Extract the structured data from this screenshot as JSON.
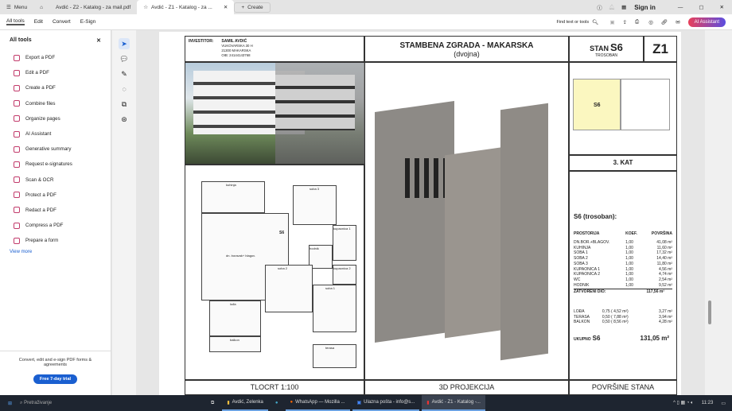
{
  "tabs": {
    "menu": "Menu",
    "tab1": "Avdić - Z2 - Katalog - za mail.pdf",
    "tab2": "Avdić - Z1 - Katalog - za ...",
    "create": "Create",
    "sign_in": "Sign in"
  },
  "toolbar": {
    "items": [
      "All tools",
      "Edit",
      "Convert",
      "E-Sign"
    ],
    "find": "Find text or tools",
    "ai": "AI Assistant"
  },
  "sidebar": {
    "title": "All tools",
    "items": [
      "Export a PDF",
      "Edit a PDF",
      "Create a PDF",
      "Combine files",
      "Organize pages",
      "AI Assistant",
      "Generative summary",
      "Request e-signatures",
      "Scan & OCR",
      "Protect a PDF",
      "Redact a PDF",
      "Compress a PDF",
      "Prepare a form"
    ],
    "view_more": "View more",
    "promo": "Convert, edit and e-sign PDF forms & agreements",
    "trial": "Free 7-day trial"
  },
  "doc": {
    "investitor_label": "INVESTITOR:",
    "investitor": "SAMIL AVDIĆ",
    "addr1": "VUKOVARSKA 30 H",
    "addr2": "21300 MAKARSKA",
    "oib": "OIB: 24144143768",
    "title": "STAMBENA ZGRADA - MAKARSKA",
    "subtitle": "(dvojna)",
    "stan_label": "STAN",
    "stan": "S6",
    "type": "TROSOBAN",
    "zgrada": "Z1",
    "floor_thumb_label": "S6",
    "kat": "3. KAT",
    "table_title": "S6 (trosoban):",
    "headers": [
      "PROSTORIJA",
      "KOEF.",
      "POVRŠINA"
    ],
    "rows": [
      [
        "DN.BOR.+BLAGOV.",
        "1,00",
        "41,08 m²"
      ],
      [
        "KUHINJA",
        "1,00",
        "11,60 m²"
      ],
      [
        "SOBA 1",
        "1,00",
        "17,32 m²"
      ],
      [
        "SOBA 2",
        "1,00",
        "14,40 m²"
      ],
      [
        "SOBA 3",
        "1,00",
        "11,80 m²"
      ],
      [
        "KUPAONICA 1",
        "1,00",
        "4,56 m²"
      ],
      [
        "KUPAONICA 2",
        "1,00",
        "4,74 m²"
      ],
      [
        "WC",
        "1,00",
        "2,54 m²"
      ],
      [
        "HODNIK",
        "1,00",
        "9,52 m²"
      ]
    ],
    "closed_label": "ZATVORENI DIO:",
    "closed": "117,56 m²",
    "open_rows": [
      [
        "LOĐA",
        "0,75 ( 4,52 m²)",
        "3,27 m²"
      ],
      [
        "TERASA",
        "0,50 ( 7,88 m²)",
        "3,94 m²"
      ],
      [
        "BALKON",
        "0,50 ( 8,56 m²)",
        "4,28 m²"
      ]
    ],
    "total_label": "UKUPNO",
    "total_unit": "S6",
    "total": "131,05 m²",
    "plan_rooms": [
      "kuhinja",
      "dn. boravak+ blagov.",
      "soba 3",
      "kupaonica 1",
      "hodnik",
      "soba 2",
      "kupaonica 2",
      "soba 1",
      "lođa",
      "balkon",
      "terasa",
      "S6"
    ],
    "captions": [
      "TLOCRT 1:100",
      "3D PROJEKCIJA",
      "POVRŠINE STANA"
    ]
  },
  "taskbar": {
    "search": "Pretraživanje",
    "apps": [
      "Avdić, Zelenka",
      "WhatsApp — Mozilla ...",
      "Ulazna pošta - info@s...",
      "Avdić - Z1 - Katalog -..."
    ],
    "time": "11:23"
  }
}
